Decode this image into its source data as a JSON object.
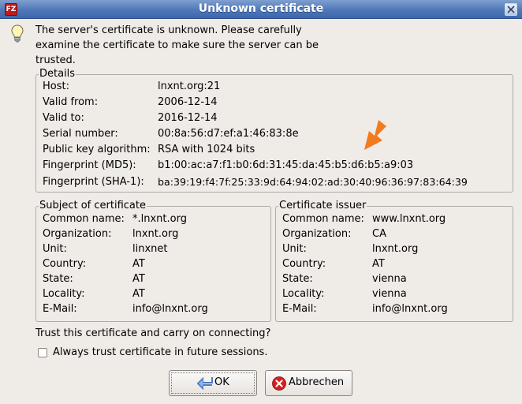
{
  "window": {
    "title": "Unknown certificate"
  },
  "message": {
    "line1": "The server's certificate is unknown. Please carefully",
    "line2": "examine the certificate to make sure the server can be",
    "line3": "trusted."
  },
  "details": {
    "legend": "Details",
    "rows": [
      {
        "label": "Host:",
        "value": "lnxnt.org:21"
      },
      {
        "label": "Valid from:",
        "value": "2006-12-14"
      },
      {
        "label": "Valid to:",
        "value": "2016-12-14"
      },
      {
        "label": "Serial number:",
        "value": "00:8a:56:d7:ef:a1:46:83:8e"
      },
      {
        "label": "Public key algorithm:",
        "value": "RSA with 1024 bits"
      },
      {
        "label": "Fingerprint (MD5):",
        "value": "b1:00:ac:a7:f1:b0:6d:31:45:da:45:b5:d6:b5:a9:03"
      },
      {
        "label": "Fingerprint (SHA-1):",
        "value": "ba:39:19:f4:7f:25:33:9d:64:94:02:ad:30:40:96:36:97:83:64:39"
      }
    ]
  },
  "subject": {
    "legend": "Subject of certificate",
    "rows": [
      {
        "label": "Common name:",
        "value": "*.lnxnt.org"
      },
      {
        "label": "Organization:",
        "value": "lnxnt.org"
      },
      {
        "label": "Unit:",
        "value": "linxnet"
      },
      {
        "label": "Country:",
        "value": "AT"
      },
      {
        "label": "State:",
        "value": "AT"
      },
      {
        "label": "Locality:",
        "value": "AT"
      },
      {
        "label": "E-Mail:",
        "value": "info@lnxnt.org"
      }
    ]
  },
  "issuer": {
    "legend": "Certificate issuer",
    "rows": [
      {
        "label": "Common name:",
        "value": "www.lnxnt.org"
      },
      {
        "label": "Organization:",
        "value": "CA"
      },
      {
        "label": "Unit:",
        "value": "lnxnt.org"
      },
      {
        "label": "Country:",
        "value": "AT"
      },
      {
        "label": "State:",
        "value": "vienna"
      },
      {
        "label": "Locality:",
        "value": "vienna"
      },
      {
        "label": "E-Mail:",
        "value": "info@lnxnt.org"
      }
    ]
  },
  "question": "Trust this certificate and carry on connecting?",
  "always_trust": {
    "label": "Always trust certificate in future sessions.",
    "checked": false
  },
  "buttons": {
    "ok": "OK",
    "cancel": "Abbrechen"
  },
  "colors": {
    "annotation_arrow": "#f47a1e",
    "titlebar": "#4f78b8",
    "cancel_icon": "#d42020"
  },
  "icons": {
    "app": "filezilla-icon",
    "close": "close-icon",
    "message": "lightbulb-icon",
    "annotation": "orange-arrow-icon",
    "ok": "ok-arrow-icon",
    "cancel": "cancel-x-icon"
  },
  "app_icon_text": "FZ"
}
